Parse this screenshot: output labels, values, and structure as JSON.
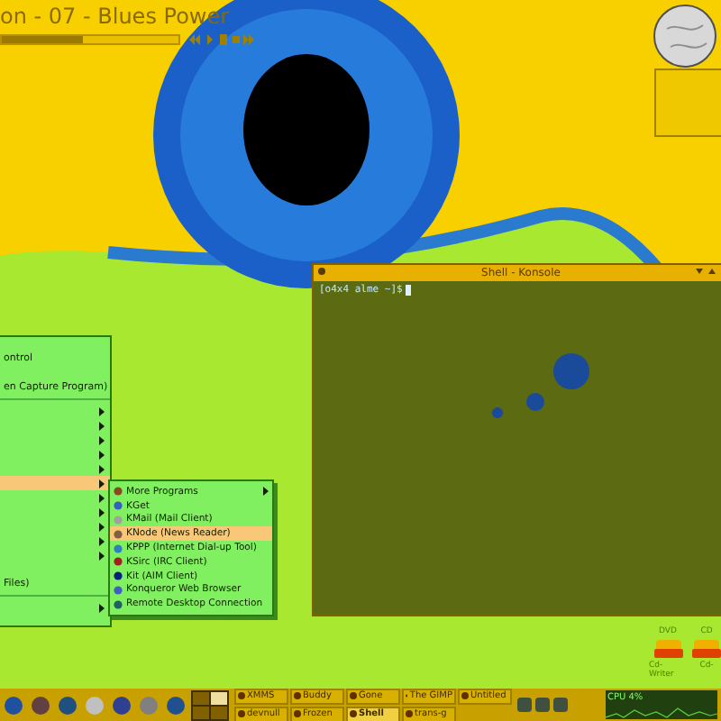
{
  "player": {
    "title": "on - 07 - Blues Power",
    "level": 0.46
  },
  "start_menu": {
    "items": [
      {
        "kind": "item",
        "label": "ontrol"
      },
      {
        "kind": "blank"
      },
      {
        "kind": "item",
        "label": "en Capture Program)"
      },
      {
        "kind": "separator"
      },
      {
        "kind": "submenu",
        "selected": false
      },
      {
        "kind": "submenu",
        "selected": false
      },
      {
        "kind": "submenu",
        "selected": false
      },
      {
        "kind": "submenu",
        "selected": false
      },
      {
        "kind": "submenu",
        "selected": false
      },
      {
        "kind": "submenu",
        "selected": true
      },
      {
        "kind": "submenu",
        "selected": false
      },
      {
        "kind": "submenu",
        "selected": false
      },
      {
        "kind": "submenu",
        "selected": false
      },
      {
        "kind": "submenu",
        "selected": false
      },
      {
        "kind": "submenu",
        "selected": false
      },
      {
        "kind": "blank"
      },
      {
        "kind": "item",
        "label": "Files)"
      },
      {
        "kind": "separator"
      },
      {
        "kind": "submenu",
        "selected": false
      }
    ]
  },
  "submenu": {
    "items": [
      {
        "label": "More Programs",
        "has_submenu": true,
        "selected": false
      },
      {
        "label": "KGet",
        "has_submenu": false,
        "selected": false
      },
      {
        "label": "KMail (Mail Client)",
        "has_submenu": false,
        "selected": false
      },
      {
        "label": "KNode (News Reader)",
        "has_submenu": false,
        "selected": true
      },
      {
        "label": "KPPP (Internet Dial-up Tool)",
        "has_submenu": false,
        "selected": false
      },
      {
        "label": "KSirc (IRC Client)",
        "has_submenu": false,
        "selected": false
      },
      {
        "label": "Kit (AIM Client)",
        "has_submenu": false,
        "selected": false
      },
      {
        "label": "Konqueror Web Browser",
        "has_submenu": false,
        "selected": false
      },
      {
        "label": "Remote Desktop Connection",
        "has_submenu": false,
        "selected": false
      }
    ]
  },
  "terminal": {
    "title": "Shell - Konsole",
    "prompt": "[o4x4 alme ~]$"
  },
  "desktop_icons": [
    {
      "label": "DVD",
      "caption": "Cd-Writer"
    },
    {
      "label": "CD",
      "caption": "Cd-"
    }
  ],
  "taskbar": {
    "pager": [
      {
        "selected": false
      },
      {
        "selected": true
      },
      {
        "selected": false
      },
      {
        "selected": false
      }
    ],
    "tasks": [
      {
        "label": "XMMS",
        "selected": false
      },
      {
        "label": "Buddy",
        "selected": false
      },
      {
        "label": "Gone",
        "selected": false
      },
      {
        "label": "The GIMP",
        "selected": false
      },
      {
        "label": "Untitled",
        "selected": false
      },
      {
        "label": "devnull",
        "selected": false
      },
      {
        "label": "Frozen",
        "selected": false
      },
      {
        "label": "Shell",
        "selected": true
      },
      {
        "label": "trans-g",
        "selected": false
      }
    ],
    "cpu": "CPU 4%"
  }
}
